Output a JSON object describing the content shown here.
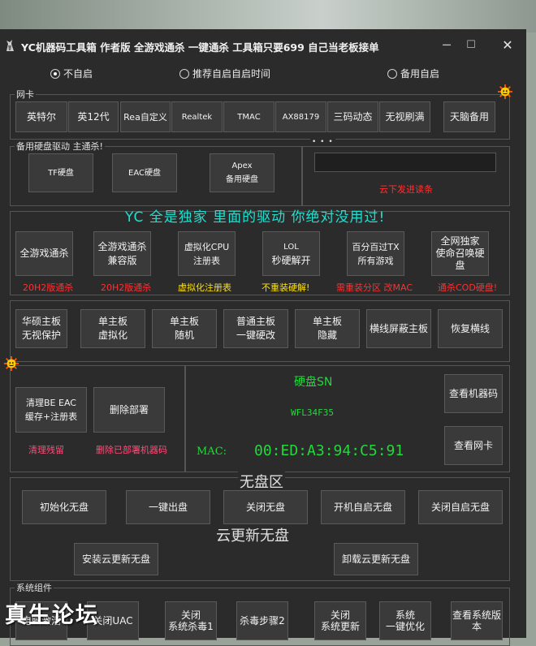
{
  "window": {
    "title": "YC机器码工具箱   作者版 全游戏通杀 一键通杀  工具箱只要699 自己当老板接单",
    "controls": {
      "minimize": "─",
      "maximize": "☐",
      "close": "✕"
    }
  },
  "startup_options": [
    {
      "label": "不自启",
      "selected": true
    },
    {
      "label": "推荐自启自启时间",
      "selected": false
    },
    {
      "label": "备用自启",
      "selected": false
    }
  ],
  "nic": {
    "group_label": "网卡",
    "buttons": [
      "英特尔",
      "英12代",
      "Rea自定义",
      "Realtek",
      "TMAC",
      "AX88179",
      "三码动态",
      "无视刷满",
      "天脑备用"
    ]
  },
  "disk_backup": {
    "group_label": "备用硬盘驱动 主通杀!",
    "buttons": [
      {
        "lines": [
          "TF硬盘"
        ]
      },
      {
        "lines": [
          "EAC硬盘"
        ]
      },
      {
        "lines": [
          "Apex",
          "备用硬盘"
        ]
      }
    ],
    "dots": "• • •",
    "input_value": "",
    "notice": "云下发进读条"
  },
  "exclusive": {
    "banner": "YC 全是独家 里面的驱动 你绝对没用过!",
    "buttons": [
      {
        "lines": [
          "全游戏通杀"
        ],
        "note": "20H2版通杀",
        "note_color": "red"
      },
      {
        "lines": [
          "全游戏通杀",
          "兼容版"
        ],
        "note": "20H2版通杀",
        "note_color": "red"
      },
      {
        "lines": [
          "虚拟化CPU",
          "注册表"
        ],
        "note": "虚拟化注册表",
        "note_color": "yellow"
      },
      {
        "lines": [
          "LOL",
          "秒硬解开"
        ],
        "note": "不重装硬解!",
        "note_color": "yellow"
      },
      {
        "lines": [
          "百分百过TX",
          "所有游戏"
        ],
        "note": "需重装分区 改MAC",
        "note_color": "red"
      },
      {
        "lines": [
          "全网独家",
          "使命召唤硬",
          "盘"
        ],
        "note": "通杀COD硬盘!",
        "note_color": "red"
      }
    ]
  },
  "board": {
    "buttons": [
      {
        "lines": [
          "华硕主板",
          "无视保护"
        ]
      },
      {
        "lines": [
          "单主板",
          "虚拟化"
        ]
      },
      {
        "lines": [
          "单主板",
          "随机"
        ]
      },
      {
        "lines": [
          "普通主板",
          "一键硬改"
        ]
      },
      {
        "lines": [
          "单主板",
          "隐藏"
        ]
      },
      {
        "lines": [
          "横线屏蔽主板"
        ]
      },
      {
        "lines": [
          "恢复横线"
        ]
      }
    ]
  },
  "cleanup": {
    "clean_button": [
      "清理BE EAC",
      "缓存+注册表"
    ],
    "delete_button": [
      "删除部署"
    ],
    "clean_note": "清理残留",
    "delete_note": "删除已部署机器码"
  },
  "info": {
    "disk_sn_label": "硬盘SN",
    "disk_sn_value": "WFL34F35",
    "mac_label": "MAC:",
    "mac_value": "00:ED:A3:94:C5:91",
    "view_machine_code": "查看机器码",
    "view_nic": "查看网卡"
  },
  "diskless": {
    "title": "无盘区",
    "buttons": [
      "初始化无盘",
      "一键出盘",
      "关闭无盘",
      "开机自启无盘",
      "关闭自启无盘"
    ],
    "cloud_title": "云更新无盘",
    "cloud_buttons": [
      "安装云更新无盘",
      "卸载云更新无盘"
    ]
  },
  "system": {
    "group_label": "系统组件",
    "buttons": [
      {
        "lines": [
          "电脑激活"
        ]
      },
      {
        "lines": [
          "关闭UAC"
        ]
      },
      {
        "lines": [
          "关闭",
          "系统杀毒1"
        ]
      },
      {
        "lines": [
          "杀毒步骤2"
        ]
      },
      {
        "lines": [
          "关闭",
          "系统更新"
        ]
      },
      {
        "lines": [
          "系统",
          "一键优化"
        ]
      },
      {
        "lines": [
          "查看系统版",
          "本"
        ]
      }
    ]
  },
  "watermark": "真生论坛",
  "colors": {
    "window_bg": "#2b2b2b",
    "button_bg": "#3a3a3a",
    "red_note": "#ff3030",
    "yellow_note": "#ffe100",
    "green_text": "#22d83a",
    "cyan_text": "#1fe0d0"
  }
}
